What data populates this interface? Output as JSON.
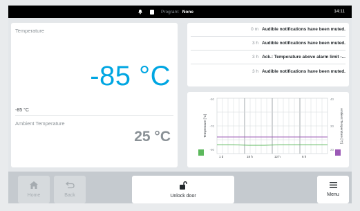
{
  "status_bar": {
    "program_label": "Program:",
    "program_value": "None",
    "time": "14:11"
  },
  "temperature_card": {
    "label": "Temperature",
    "value": "-85 °C",
    "small_value": "-85 °C",
    "ambient_label": "Ambient Temperature",
    "ambient_value": "25 °C"
  },
  "notifications": [
    {
      "time": "0 m",
      "message": "Audible notifications have been muted."
    },
    {
      "time": "3 h",
      "message": "Audible notifications have been muted."
    },
    {
      "time": "3 h",
      "message": "Ack.: Temperature above alarm limit -..."
    },
    {
      "time": "3 h",
      "message": "Audible notifications have been muted."
    }
  ],
  "chart_data": {
    "type": "line",
    "ylabel": "Temperature [°C]",
    "y2label": "Ambient Temperature [°C]",
    "y_ticks": [
      "-50",
      "-70",
      "-90"
    ],
    "y2_ticks": [
      "40",
      "30",
      "20"
    ],
    "x_ticks": [
      "1 d",
      "18 h",
      "12 h",
      "6 h"
    ],
    "ylim": [
      -100,
      -50
    ],
    "y2lim": [
      10,
      45
    ],
    "series": [
      {
        "values": [
          -85,
          -85,
          -85,
          -85,
          -85,
          -85,
          -85,
          -85
        ],
        "color": "#9b59b6"
      },
      {
        "values": [
          -92,
          -92,
          -92.5,
          -92.5,
          -92,
          -92,
          -92,
          -92
        ],
        "color": "#5cb85c"
      }
    ],
    "grid": true
  },
  "bottom_bar": {
    "home_label": "Home",
    "back_label": "Back",
    "unlock_label": "Unlock door",
    "menu_label": "Menu"
  },
  "colors": {
    "accent": "#00a6e2",
    "temp_series": "#9b59b6",
    "ambient_series": "#5cb85c"
  }
}
